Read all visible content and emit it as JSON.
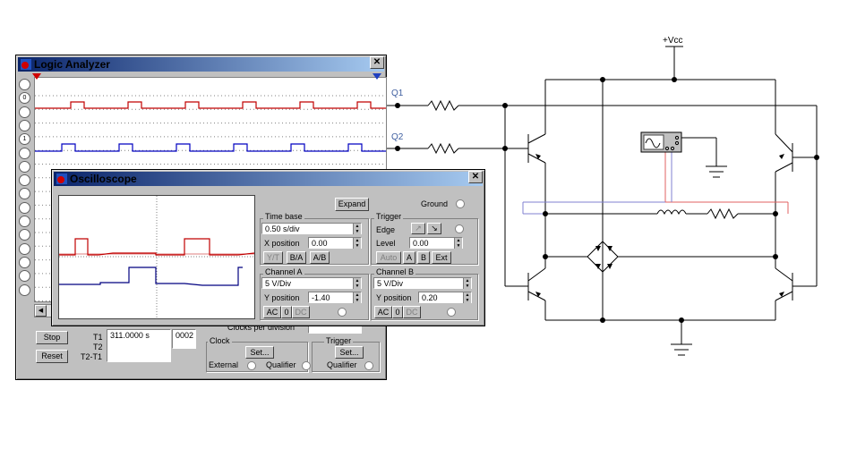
{
  "circuit": {
    "vcc_label": "+Vcc",
    "q1_label": "Q1",
    "q2_label": "Q2"
  },
  "logic_analyzer": {
    "title": "Logic Analyzer",
    "close_glyph": "✕",
    "channel_values": [
      "",
      "0",
      "",
      "",
      "1",
      "",
      "",
      "",
      "",
      "",
      "",
      "",
      "",
      "",
      "",
      ""
    ],
    "stop_label": "Stop",
    "reset_label": "Reset",
    "t1_label": "T1",
    "t2_label": "T2",
    "t2t1_label": "T2-T1",
    "t1_value": "311.0000  s",
    "t1_extra": "0002",
    "clocks_per_division_label": "Clocks per division",
    "clock_group": "Clock",
    "clock_set": "Set...",
    "external_label": "External",
    "qualifier_label": "Qualifier",
    "trigger_group": "Trigger",
    "trigger_set": "Set...",
    "trigger_qualifier": "Qualifier",
    "colors": {
      "ch1": "#c00000",
      "ch2": "#0000c0"
    }
  },
  "oscilloscope": {
    "title": "Oscilloscope",
    "close_glyph": "✕",
    "expand_label": "Expand",
    "ground_label": "Ground",
    "timebase": {
      "group": "Time base",
      "value": "0.50 s/div",
      "xpos_label": "X position",
      "xpos_value": "0.00",
      "yt": "Y/T",
      "ba": "B/A",
      "ab": "A/B"
    },
    "trigger": {
      "group": "Trigger",
      "edge_label": "Edge",
      "level_label": "Level",
      "level_value": "0.00",
      "auto": "Auto",
      "a": "A",
      "b": "B",
      "ext": "Ext"
    },
    "channel_a": {
      "group": "Channel A",
      "value": "5  V/Div",
      "ypos_label": "Y position",
      "ypos_value": "-1.40",
      "ac": "AC",
      "zero": "0",
      "dc": "DC"
    },
    "channel_b": {
      "group": "Channel B",
      "value": "5  V/Div",
      "ypos_label": "Y position",
      "ypos_value": "0.20",
      "ac": "AC",
      "zero": "0",
      "dc": "DC"
    }
  }
}
